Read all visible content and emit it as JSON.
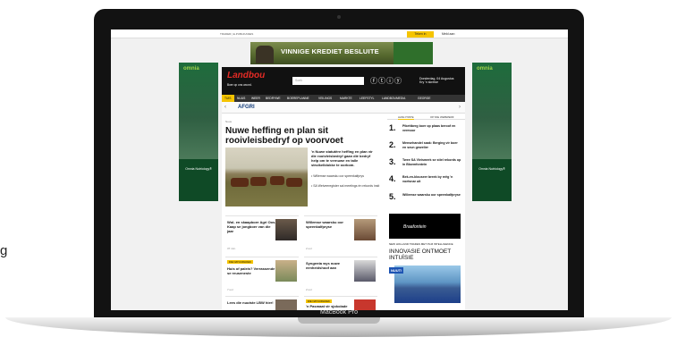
{
  "fragment": "g",
  "device_label": "MacBook Pro",
  "topbar": {
    "links": "TRADER | E-PUBLIKASIES",
    "login": "Teken in",
    "register": "Meld aan"
  },
  "banner_ad": {
    "text": "VINNIGE KREDIET BESLUITE"
  },
  "side_ads": {
    "logo": "omnia",
    "caption": "Omnia Nutriology®"
  },
  "masthead": {
    "logo": "Landbou",
    "slogan": "Boer op ons woord.",
    "search_placeholder": "Soek",
    "date_line1": "Donderdag, 04 Augustus",
    "date_line2": "Kry 'n skrewe"
  },
  "nav": {
    "items": [
      "TUIS",
      "NUUS",
      "WEER",
      "BEDRYWE",
      "BOEREPLANNE",
      "VEILINGS",
      "MARKTE",
      "LEEFSTYL",
      "LANDBOUMEDIA",
      "GEORGE"
    ]
  },
  "ticker": {
    "sponsor": "AFGRI"
  },
  "article": {
    "breadcrumb": "Nuus",
    "headline": "Nuwe heffing en plan sit rooivleisbedryf op voorvoet",
    "lead": "'n Nuwe statutêre heffing en plan vir die rooivleisbedryf gaan dié bedryf help om te vernuwe en talle struikelblokke te oorkom.",
    "related": [
      "Willemse waarsku oor speenkalfprys",
      "SA Weiveeregister sal meetings én rekords insit"
    ]
  },
  "cards": [
    {
      "title": "Wol- en skaapboer Agri Oos-Kaap se jongboer van die jaar",
      "meta": "37 min.",
      "badge": ""
    },
    {
      "title": "Willemse waarsku oor speenkalfpryse",
      "meta": "2 uur",
      "badge": ""
    },
    {
      "title": "Huis of paleis? Verrassende se reuseneste",
      "meta": "7 uur",
      "badge": "DIE NATUURHOEK"
    },
    {
      "title": "Syngenta wys nuwe eenheidshoof aan",
      "meta": "2 uur",
      "badge": ""
    },
    {
      "title": "Lees die nuutste LBW hier!",
      "meta": "",
      "badge": ""
    },
    {
      "title": "'n Pasmaat vir sjokolade",
      "meta": "",
      "badge": "DIE NATUURHOEK"
    }
  ],
  "sidebar": {
    "tab1": "AANLYNSTE",
    "tab2": "OP DIE WEBWERF",
    "most_read": [
      "Pikettberg boer op plaas beroof en vermoor",
      "Mensehandel saak: Berging vir boer en seun gewelier",
      "Twee SA Vleismerk se stiel rekords op in Bloemfontein",
      "Bek-en-klouseer breek by reëg 'n voetsnar uit",
      "Willemse waarsku oor speenkalfpryse"
    ],
    "ad_label": "Braafontein",
    "ad2": {
      "small": "NEW HOLLAND TRADES MET PLM INTELLIGENCE",
      "big": "INNOVASIE ONTMOET INTUÏSIE",
      "tag": "NUUT!"
    }
  }
}
